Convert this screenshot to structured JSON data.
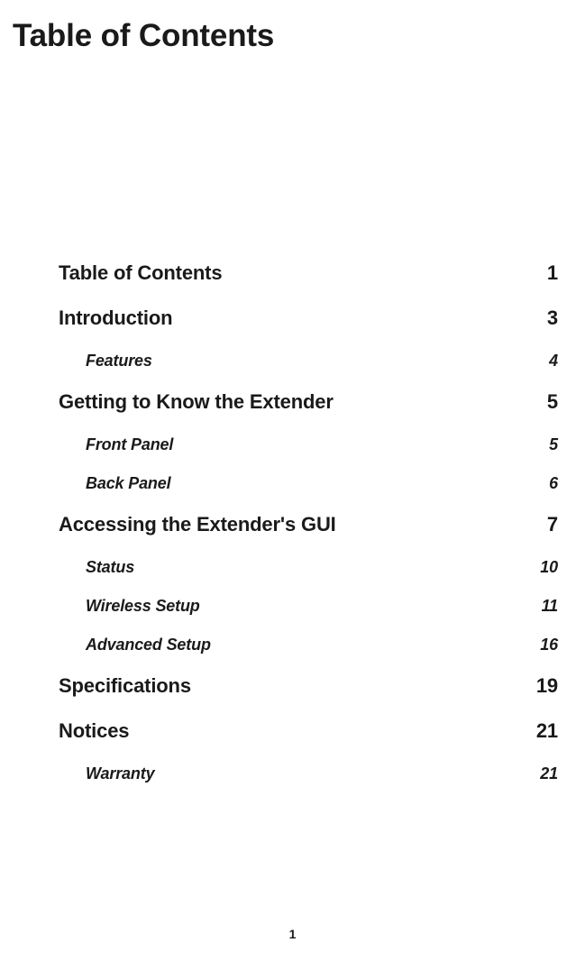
{
  "title": "Table of Contents",
  "entries": [
    {
      "label": "Table of Contents",
      "page": "1",
      "level": 0
    },
    {
      "label": "Introduction",
      "page": "3",
      "level": 0
    },
    {
      "label": "Features",
      "page": "4",
      "level": 1
    },
    {
      "label": "Getting to Know the Extender",
      "page": "5",
      "level": 0
    },
    {
      "label": "Front Panel",
      "page": "5",
      "level": 1
    },
    {
      "label": "Back Panel",
      "page": "6",
      "level": 1
    },
    {
      "label": "Accessing the Extender's GUI",
      "page": "7",
      "level": 0
    },
    {
      "label": "Status",
      "page": "10",
      "level": 1
    },
    {
      "label": "Wireless Setup",
      "page": "11",
      "level": 1
    },
    {
      "label": "Advanced Setup",
      "page": "16",
      "level": 1
    },
    {
      "label": "Specifications",
      "page": "19",
      "level": 0
    },
    {
      "label": "Notices",
      "page": "21",
      "level": 0
    },
    {
      "label": "Warranty",
      "page": "21",
      "level": 1
    }
  ],
  "pageNumber": "1"
}
